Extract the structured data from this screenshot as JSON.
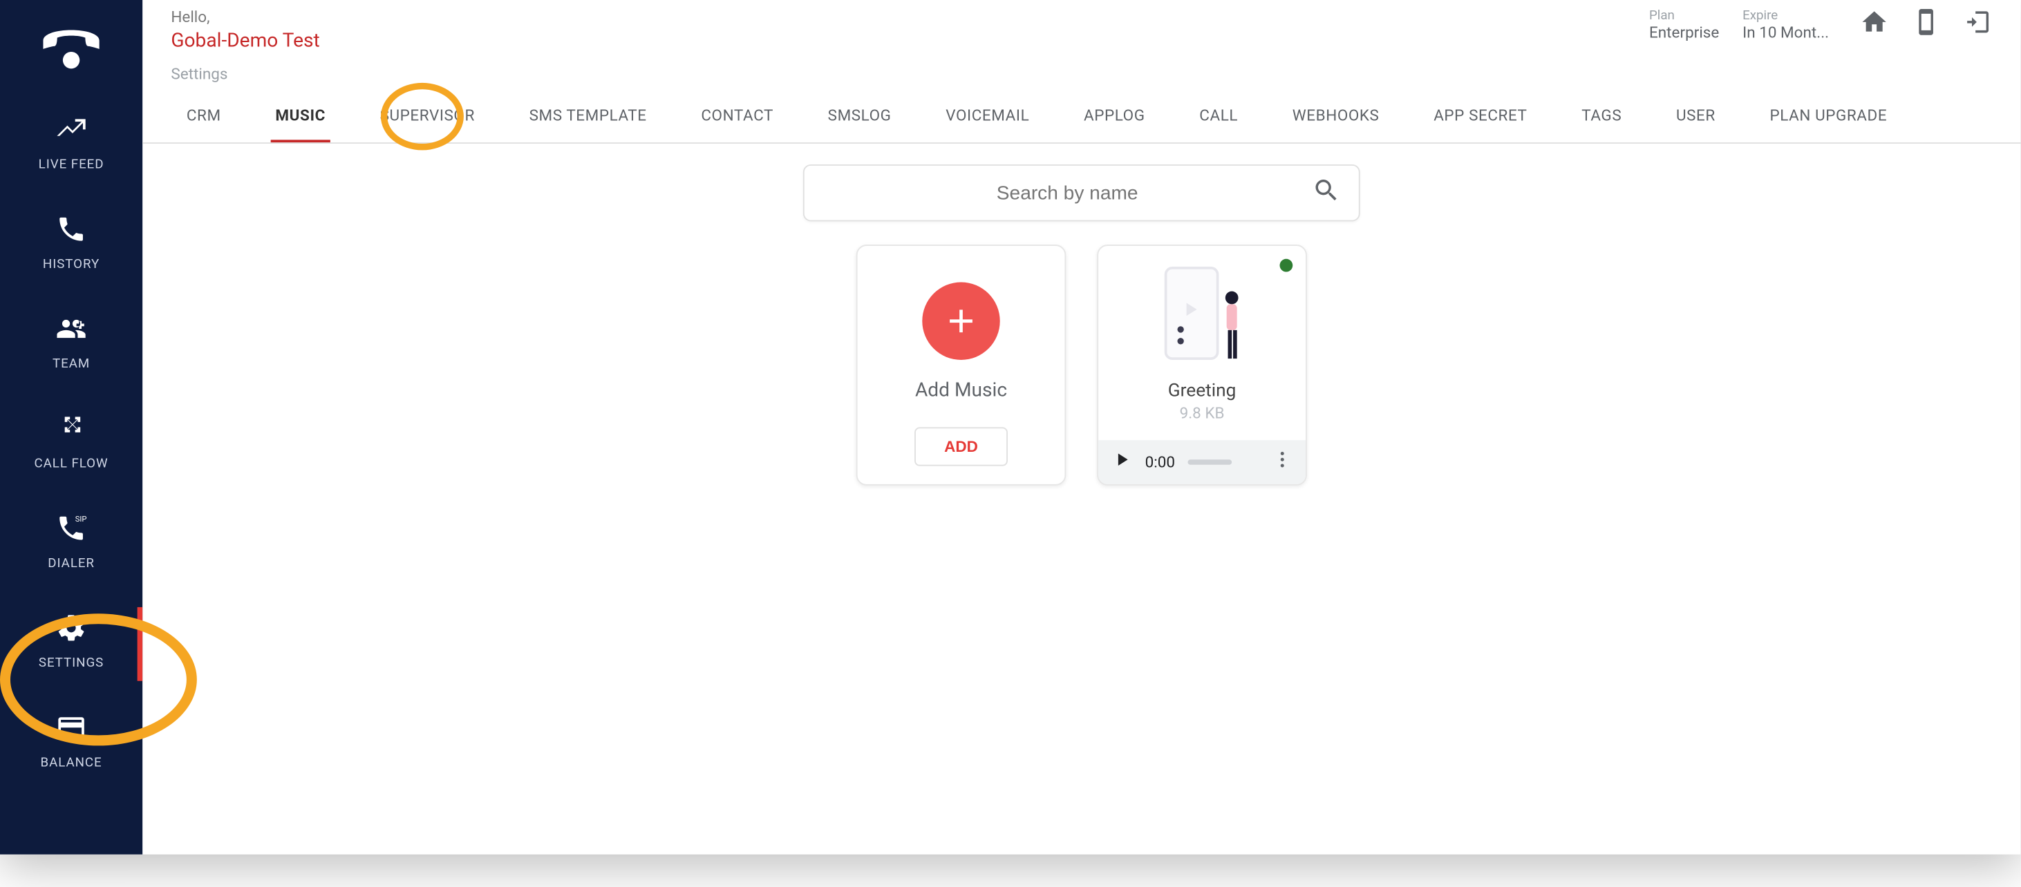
{
  "header": {
    "hello": "Hello,",
    "user_name": "Gobal-Demo Test",
    "plan_label": "Plan",
    "plan_value": "Enterprise",
    "expire_label": "Expire",
    "expire_value": "In 10 Mont..."
  },
  "breadcrumb": "Settings",
  "tabs": [
    {
      "label": "CRM"
    },
    {
      "label": "MUSIC",
      "active": true
    },
    {
      "label": "SUPERVISOR"
    },
    {
      "label": "SMS TEMPLATE"
    },
    {
      "label": "CONTACT"
    },
    {
      "label": "SMSLOG"
    },
    {
      "label": "VOICEMAIL"
    },
    {
      "label": "APPLOG"
    },
    {
      "label": "CALL"
    },
    {
      "label": "WEBHOOKS"
    },
    {
      "label": "APP SECRET"
    },
    {
      "label": "TAGS"
    },
    {
      "label": "USER"
    },
    {
      "label": "PLAN UPGRADE"
    }
  ],
  "sidebar": {
    "items": [
      {
        "label": "LIVE FEED",
        "icon": "trend"
      },
      {
        "label": "HISTORY",
        "icon": "phone"
      },
      {
        "label": "TEAM",
        "icon": "team"
      },
      {
        "label": "CALL FLOW",
        "icon": "split"
      },
      {
        "label": "DIALER",
        "icon": "dialer"
      },
      {
        "label": "SETTINGS",
        "icon": "gear",
        "active": true
      },
      {
        "label": "BALANCE",
        "icon": "card"
      }
    ]
  },
  "search": {
    "placeholder": "Search by name"
  },
  "add_card": {
    "title": "Add Music",
    "button": "ADD"
  },
  "music_item": {
    "name": "Greeting",
    "size": "9.8 KB",
    "time": "0:00",
    "status": "active"
  }
}
